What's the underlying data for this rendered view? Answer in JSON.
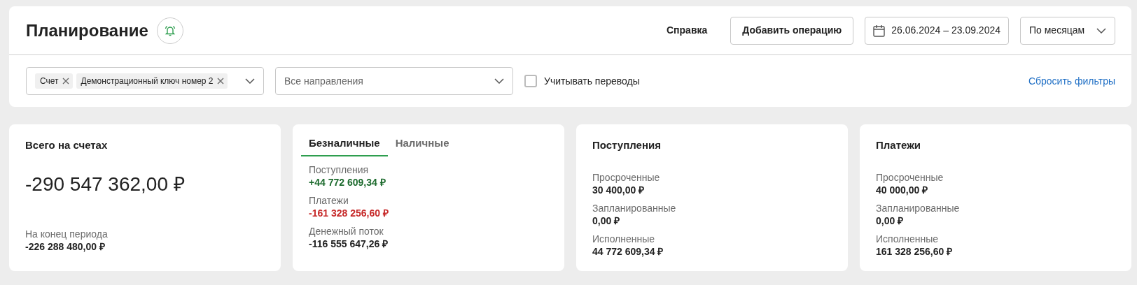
{
  "header": {
    "title": "Планирование",
    "help_link": "Справка",
    "add_button": "Добавить операцию",
    "date_range": "26.06.2024 – 23.09.2024",
    "period_select": "По месяцам"
  },
  "filters": {
    "account_chips": [
      {
        "label": "Счет"
      },
      {
        "label": "Демонстрационный ключ номер 2"
      }
    ],
    "directions": {
      "placeholder": "Все направления"
    },
    "transfers": {
      "label": "Учитывать переводы",
      "checked": false
    },
    "reset_link": "Сбросить фильтры"
  },
  "cards": [
    {
      "kind": "total",
      "title": "Всего на счетах",
      "amount": "-290 547 362,00 ₽",
      "rows": [
        {
          "label": "На конец периода",
          "value": "-226 288 480,00 ₽"
        }
      ]
    },
    {
      "kind": "tabs",
      "tabs": [
        {
          "label": "Безналичные",
          "selected": true
        },
        {
          "label": "Наличные",
          "selected": false
        }
      ],
      "rows": [
        {
          "label": "Поступления",
          "value": "+44 772 609,34 ₽",
          "color": "#1d6b2e"
        },
        {
          "label": "Платежи",
          "value": "-161 328 256,60 ₽",
          "color": "#c62828"
        },
        {
          "label": "Денежный поток",
          "value": "-116 555 647,26 ₽",
          "color": "#222222"
        }
      ]
    },
    {
      "kind": "summary",
      "title": "Поступления",
      "rows": [
        {
          "label": "Просроченные",
          "value": "30 400,00 ₽"
        },
        {
          "label": "Запланированные",
          "value": "0,00 ₽"
        },
        {
          "label": "Исполненные",
          "value": "44 772 609,34 ₽"
        }
      ]
    },
    {
      "kind": "summary",
      "title": "Платежи",
      "rows": [
        {
          "label": "Просроченные",
          "value": "40 000,00 ₽"
        },
        {
          "label": "Запланированные",
          "value": "0,00 ₽"
        },
        {
          "label": "Исполненные",
          "value": "161 328 256,60 ₽"
        }
      ]
    }
  ]
}
